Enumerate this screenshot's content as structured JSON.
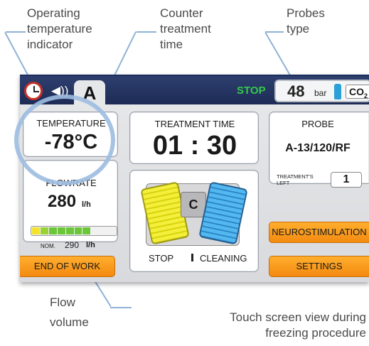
{
  "callouts": {
    "temp_indicator": [
      "Operating",
      "temperature",
      "indicator"
    ],
    "counter_time": [
      "Counter",
      "treatment",
      "time"
    ],
    "probes_type": [
      "Probes",
      "type"
    ],
    "flow_volume": [
      "Flow",
      "volume"
    ],
    "caption": [
      "Touch screen view during",
      "freezing procedure"
    ]
  },
  "topbar": {
    "channel": "A",
    "status": "STOP",
    "pressure_value": "48",
    "pressure_unit": "bar",
    "gas": "CO",
    "gas_sub": "2",
    "icons": [
      "clock-icon",
      "speaker-icon",
      "co2-bottle-icon"
    ]
  },
  "temperature": {
    "label": "TEMPERATURE",
    "value": "-78°C"
  },
  "treatment": {
    "label": "TREATMENT TIME",
    "value": "01 : 30"
  },
  "probe": {
    "label": "PROBE",
    "name": "A-13/120/RF",
    "treatments_left_label_1": "TREATMENT'S",
    "treatments_left_label_2": "LEFT",
    "treatments_left_value": "1"
  },
  "flowrate": {
    "label": "FLOWRATE",
    "value": "280",
    "unit": "l/h",
    "bar_fill": 0.7,
    "nominal_label": "NOM.",
    "nominal_value": "290",
    "nominal_unit": "l/h"
  },
  "center_panel": {
    "center_letter": "C",
    "stop_label": "STOP",
    "cleaning_label": "CLEANING"
  },
  "buttons": {
    "end_of_work": "END OF WORK",
    "neurostimulation": "NEUROSTIMULATION",
    "settings": "SETTINGS"
  },
  "colors": {
    "topbar": "#1d2b55",
    "status_green": "#35c84a",
    "orange_button": "#f38a10",
    "highlight_ring": "#9dbde1"
  }
}
